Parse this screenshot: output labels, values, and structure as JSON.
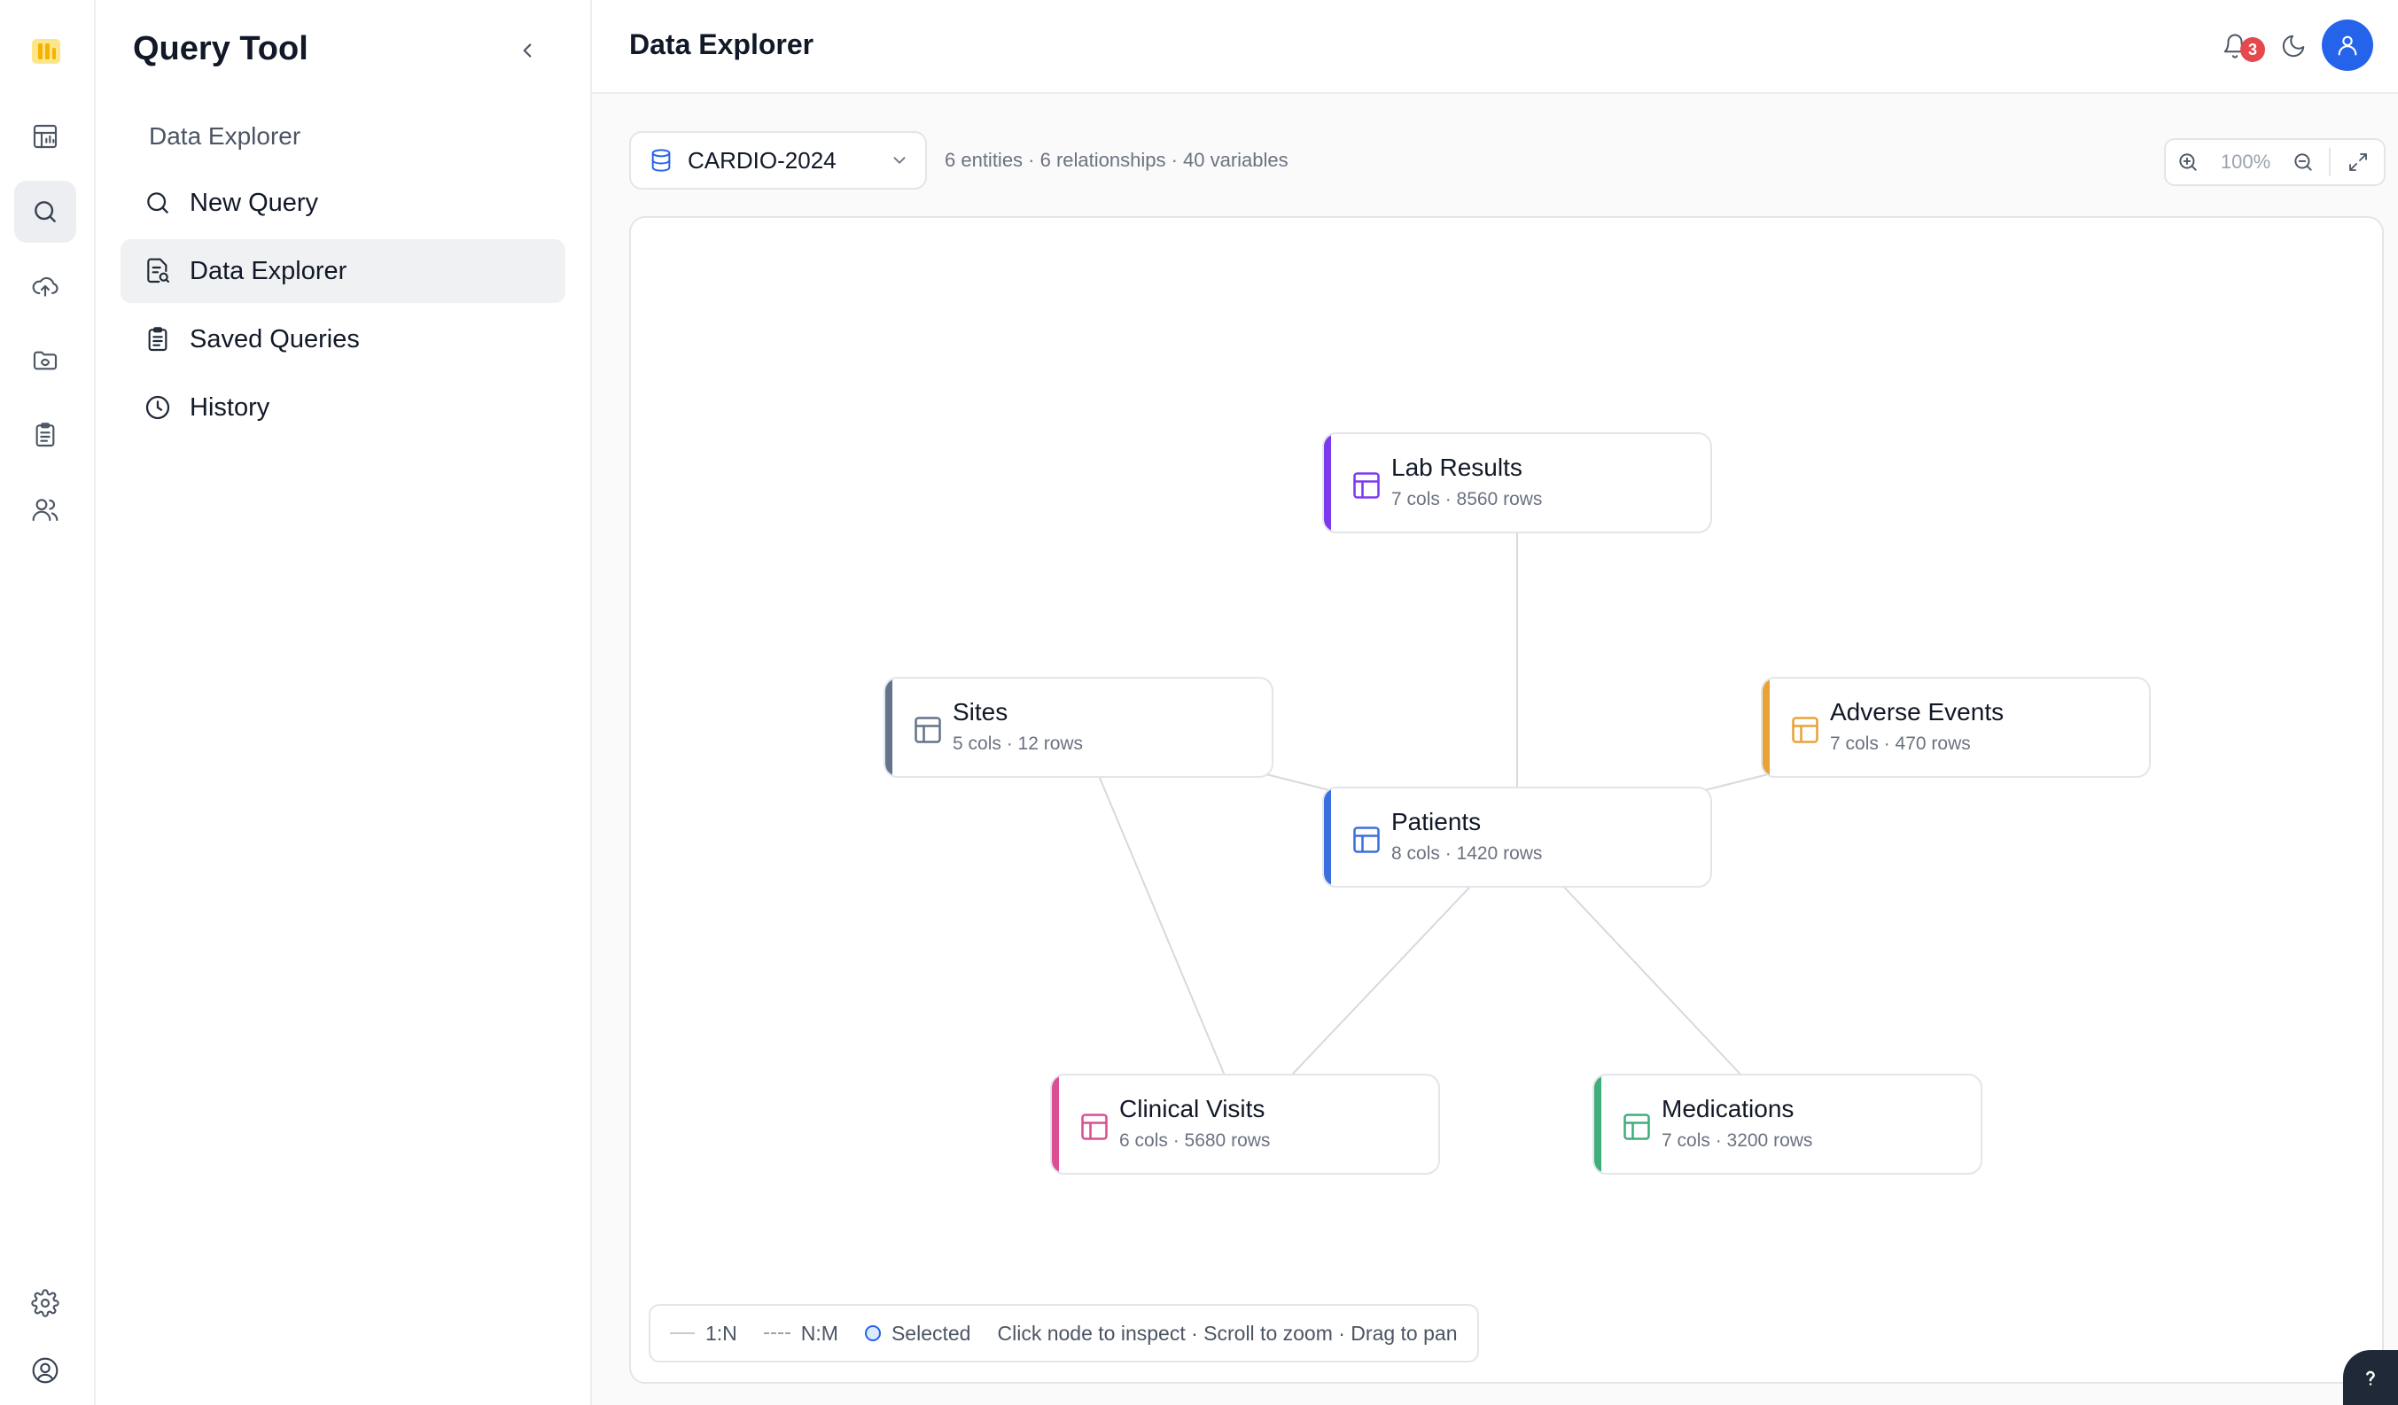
{
  "app": {
    "title": "Query Tool"
  },
  "sidebar": {
    "section_label": "Data Explorer",
    "items": [
      {
        "label": "New Query",
        "icon": "search-icon"
      },
      {
        "label": "Data Explorer",
        "icon": "file-search-icon"
      },
      {
        "label": "Saved Queries",
        "icon": "clipboard-icon"
      },
      {
        "label": "History",
        "icon": "clock-icon"
      }
    ],
    "active_item": "Data Explorer"
  },
  "rail": {
    "items": [
      "dashboard-icon",
      "search-icon",
      "upload-cloud-icon",
      "folder-sync-icon",
      "clipboard-icon",
      "users-icon"
    ],
    "bottom": [
      "settings-icon",
      "user-icon"
    ]
  },
  "header": {
    "title": "Data Explorer",
    "notification_count": "3"
  },
  "toolbar": {
    "dataset": "CARDIO-2024",
    "stats": "6 entities · 6 relationships · 40 variables",
    "zoom": "100%"
  },
  "graph": {
    "nodes": {
      "lab_results": {
        "name": "Lab Results",
        "meta": "7 cols · 8560 rows",
        "color": "#7c3aed"
      },
      "sites": {
        "name": "Sites",
        "meta": "5 cols · 12 rows",
        "color": "#64748b"
      },
      "adverse_events": {
        "name": "Adverse Events",
        "meta": "7 cols · 470 rows",
        "color": "#e8a23a"
      },
      "patients": {
        "name": "Patients",
        "meta": "8 cols · 1420 rows",
        "color": "#3b6fe0"
      },
      "clinical_visits": {
        "name": "Clinical Visits",
        "meta": "6 cols · 5680 rows",
        "color": "#db4f92"
      },
      "medications": {
        "name": "Medications",
        "meta": "7 cols · 3200 rows",
        "color": "#3fae7a"
      }
    },
    "edges": [
      [
        "lab_results",
        "patients"
      ],
      [
        "sites",
        "patients"
      ],
      [
        "adverse_events",
        "patients"
      ],
      [
        "patients",
        "clinical_visits"
      ],
      [
        "patients",
        "medications"
      ],
      [
        "sites",
        "clinical_visits"
      ]
    ]
  },
  "legend": {
    "one_to_many": "1:N",
    "many_to_many": "N:M",
    "selected": "Selected",
    "hint": "Click node to inspect · Scroll to zoom · Drag to pan"
  },
  "colors": {
    "accent": "#2563eb",
    "notification": "#e5484d"
  }
}
